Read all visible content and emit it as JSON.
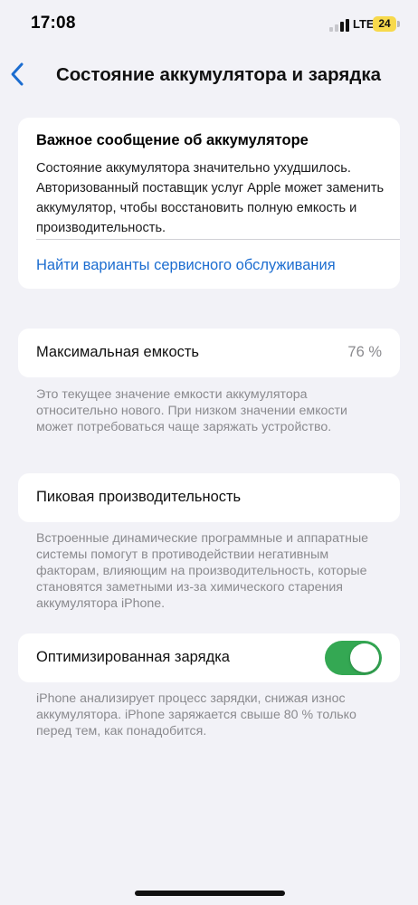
{
  "status_bar": {
    "time": "17:08",
    "network": "LTE",
    "battery_level": "24",
    "battery_color": "#f7d94c",
    "icons": [
      "signal-icon",
      "battery-icon"
    ]
  },
  "nav": {
    "back_icon": "chevron-left-icon",
    "title": "Состояние аккумулятора и зарядка",
    "accent_color": "#1c6dd0"
  },
  "important_message": {
    "title": "Важное сообщение об аккумуляторе",
    "body": "Состояние аккумулятора значительно ухудшилось. Авторизованный поставщик услуг Apple может заменить аккумулятор, чтобы восстановить полную емкость и производительность.",
    "link": "Найти варианты сервисного обслуживания"
  },
  "max_capacity": {
    "label": "Максимальная емкость",
    "value": "76 %",
    "footnote": "Это текущее значение емкости аккумулятора относительно нового. При низком значении емкости может потребоваться чаще заряжать устройство."
  },
  "peak_performance": {
    "label": "Пиковая производительность",
    "footnote": "Встроенные динамические программные и аппаратные системы помогут в противодействии негативным факторам, влияющим на производительность, которые становятся заметными из-за химического старения аккумулятора iPhone."
  },
  "optimized_charging": {
    "label": "Оптимизированная зарядка",
    "enabled": true,
    "toggle_color": "#34a853",
    "footnote": "iPhone анализирует процесс зарядки, снижая износ аккумулятора. iPhone заряжается свыше 80 % только перед тем, как понадобится."
  }
}
